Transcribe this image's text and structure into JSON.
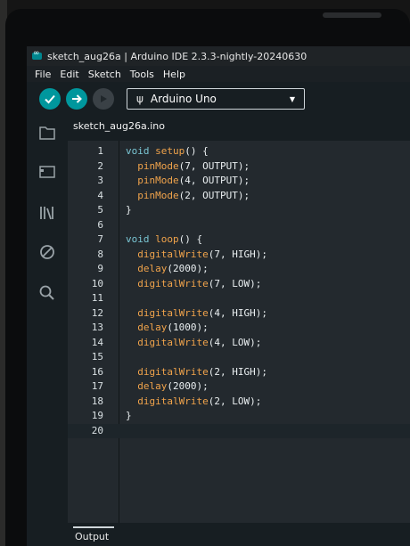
{
  "window": {
    "title": "sketch_aug26a | Arduino IDE 2.3.3-nightly-20240630"
  },
  "menu": [
    "File",
    "Edit",
    "Sketch",
    "Tools",
    "Help"
  ],
  "toolbar": {
    "verify_icon": "check-icon",
    "upload_icon": "arrow-right-icon",
    "debug_icon": "debug-icon",
    "board": "Arduino Uno"
  },
  "sidebar_icons": [
    "folder-icon",
    "boards-manager-icon",
    "library-icon",
    "debug-disabled-icon",
    "search-icon"
  ],
  "editor": {
    "tab": "sketch_aug26a.ino",
    "current_line": 20
  },
  "code": [
    {
      "n": "1",
      "t": "void setup() {"
    },
    {
      "n": "2",
      "t": "  pinMode(7, OUTPUT);"
    },
    {
      "n": "3",
      "t": "  pinMode(4, OUTPUT);"
    },
    {
      "n": "4",
      "t": "  pinMode(2, OUTPUT);"
    },
    {
      "n": "5",
      "t": "}"
    },
    {
      "n": "6",
      "t": ""
    },
    {
      "n": "7",
      "t": "void loop() {"
    },
    {
      "n": "8",
      "t": "  digitalWrite(7, HIGH);"
    },
    {
      "n": "9",
      "t": "  delay(2000);"
    },
    {
      "n": "10",
      "t": "  digitalWrite(7, LOW);"
    },
    {
      "n": "11",
      "t": ""
    },
    {
      "n": "12",
      "t": "  digitalWrite(4, HIGH);"
    },
    {
      "n": "13",
      "t": "  delay(1000);"
    },
    {
      "n": "14",
      "t": "  digitalWrite(4, LOW);"
    },
    {
      "n": "15",
      "t": ""
    },
    {
      "n": "16",
      "t": "  digitalWrite(2, HIGH);"
    },
    {
      "n": "17",
      "t": "  delay(2000);"
    },
    {
      "n": "18",
      "t": "  digitalWrite(2, LOW);"
    },
    {
      "n": "19",
      "t": "}"
    },
    {
      "n": "20",
      "t": ""
    }
  ],
  "panel": {
    "output_label": "Output"
  },
  "colors": {
    "accent": "#00979d",
    "keyword": "#7ac6d4",
    "function": "#f0a34b",
    "text": "#e9eef0"
  }
}
